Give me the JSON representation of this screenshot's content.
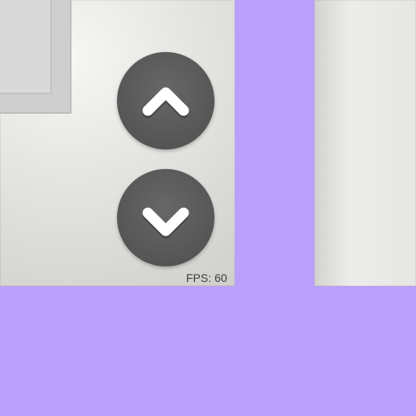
{
  "controls": {
    "up_icon": "chevron-up-icon",
    "down_icon": "chevron-down-icon"
  },
  "status": {
    "fps_text": "FPS: 60"
  },
  "colors": {
    "background": "#b8a0fb",
    "button": "#5a5a5a",
    "icon": "#ffffff"
  }
}
